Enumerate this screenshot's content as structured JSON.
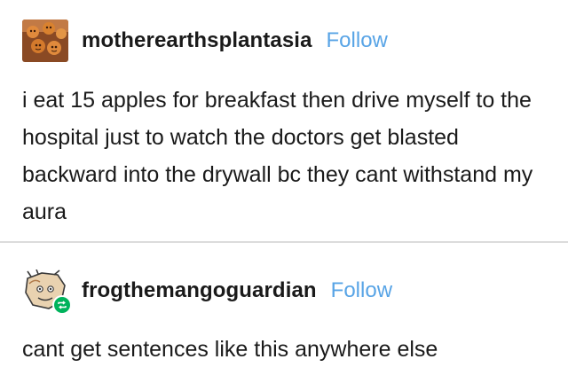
{
  "posts": [
    {
      "username": "motherearthsplantasia",
      "follow_label": "Follow",
      "avatar_icon": "cookie-faces-avatar",
      "body": "i eat 15 apples for breakfast then drive myself to the hospital just to watch the doctors get blasted backward into the drywall bc they cant withstand my aura"
    },
    {
      "username": "frogthemangoguardian",
      "follow_label": "Follow",
      "avatar_icon": "cartoon-character-avatar",
      "badge_icon": "reblog-icon",
      "body": "cant get sentences like this anywhere else"
    }
  ],
  "colors": {
    "follow": "#58a4e6",
    "text": "#1a1a1a",
    "divider": "#dcdcdc",
    "badge": "#00b35c"
  }
}
